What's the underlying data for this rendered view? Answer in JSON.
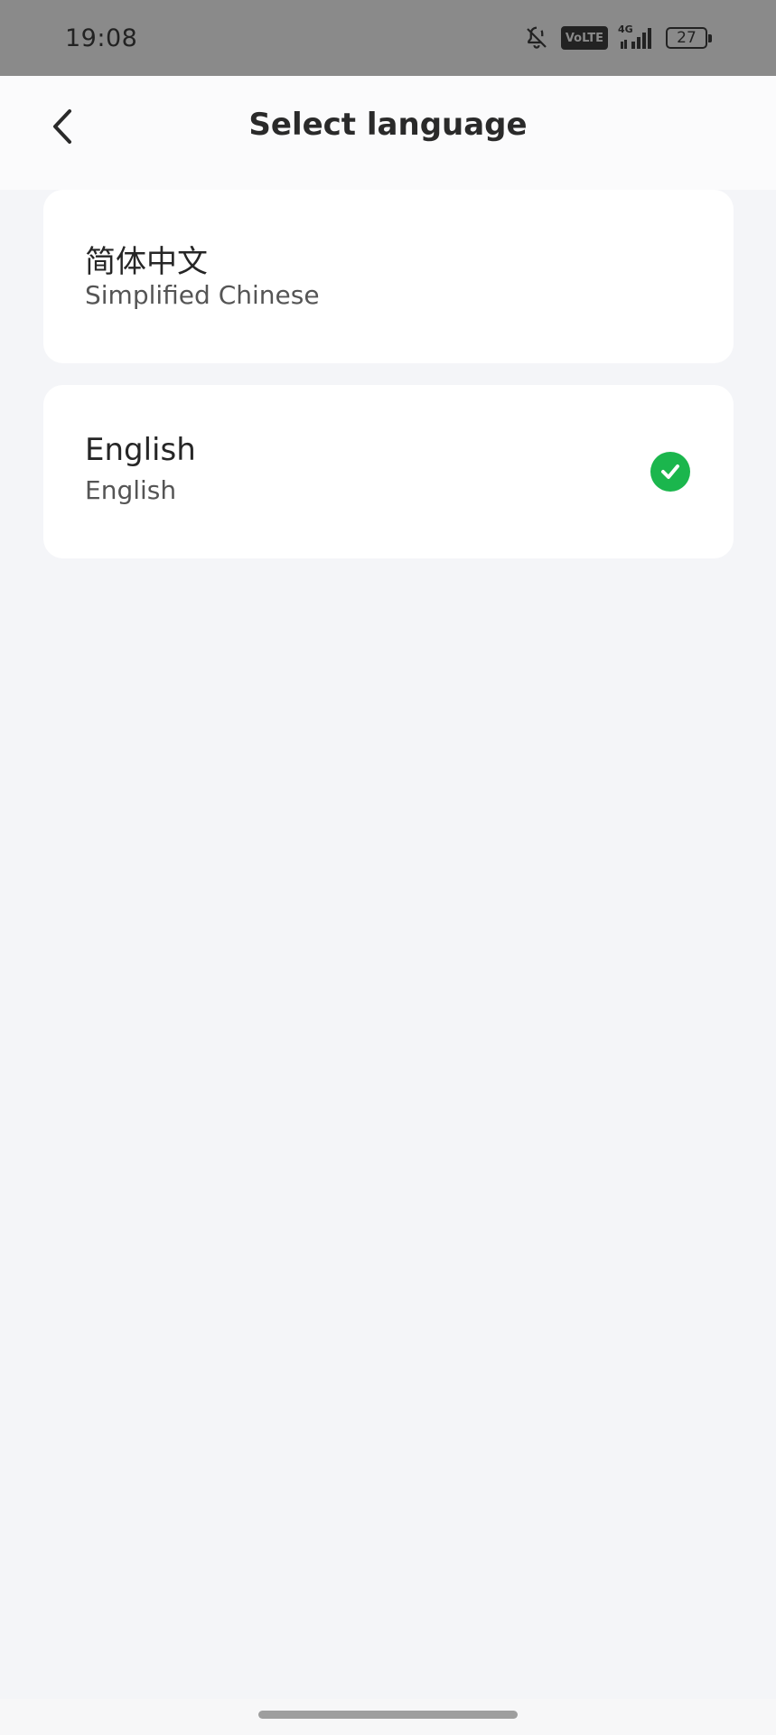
{
  "status_bar": {
    "time": "19:08",
    "volte": "VoLTE",
    "network": "4G",
    "battery": "27",
    "icons": [
      "bell-off-icon",
      "volte-badge",
      "signal-icon",
      "battery-icon"
    ]
  },
  "header": {
    "title": "Select language",
    "back_icon": "chevron-left-icon"
  },
  "languages": [
    {
      "primary": "简体中文",
      "secondary": "Simplified Chinese",
      "selected": false
    },
    {
      "primary": "English",
      "secondary": "English",
      "selected": true
    }
  ],
  "colors": {
    "status_bar_bg": "#8a8a8a",
    "page_bg": "#f4f5f8",
    "card_bg": "#ffffff",
    "accent_check": "#1bb64d",
    "text_primary": "#262626",
    "text_secondary": "#555555"
  }
}
